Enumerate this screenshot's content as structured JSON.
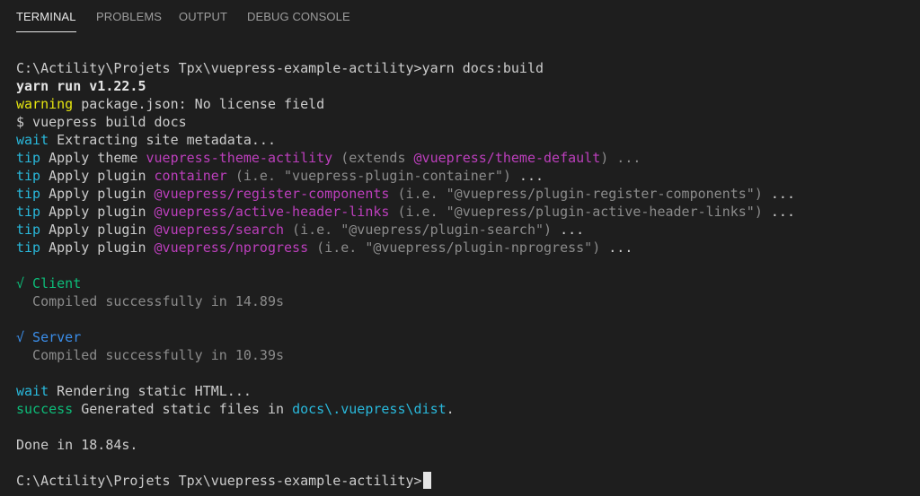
{
  "tabs": {
    "terminal": "TERMINAL",
    "problems": "PROBLEMS",
    "output": "OUTPUT",
    "debug_console": "DEBUG CONSOLE"
  },
  "terminal": {
    "prompt_command": "C:\\Actility\\Projets Tpx\\vuepress-example-actility>yarn docs:build",
    "yarn_run": "yarn run v1.22.5",
    "warning_tag": "warning",
    "warning_text": " package.json: No license field",
    "build_cmd": "$ vuepress build docs",
    "wait1_tag": "wait",
    "wait1_text": " Extracting site metadata...",
    "tip_tag": "tip",
    "theme": {
      "prefix": " Apply theme ",
      "name": "vuepress-theme-actility",
      "mid": " (extends ",
      "ext": "@vuepress/theme-default",
      "suffix": ") ..."
    },
    "plugins": [
      {
        "prefix": " Apply plugin ",
        "name": "container",
        "info": " (i.e. \"vuepress-plugin-container\")",
        "suffix": " ..."
      },
      {
        "prefix": " Apply plugin ",
        "name": "@vuepress/register-components",
        "info": " (i.e. \"@vuepress/plugin-register-components\")",
        "suffix": " ..."
      },
      {
        "prefix": " Apply plugin ",
        "name": "@vuepress/active-header-links",
        "info": " (i.e. \"@vuepress/plugin-active-header-links\")",
        "suffix": " ..."
      },
      {
        "prefix": " Apply plugin ",
        "name": "@vuepress/search",
        "info": " (i.e. \"@vuepress/plugin-search\")",
        "suffix": " ..."
      },
      {
        "prefix": " Apply plugin ",
        "name": "@vuepress/nprogress",
        "info": " (i.e. \"@vuepress/plugin-nprogress\")",
        "suffix": " ..."
      }
    ],
    "client": {
      "check": "√",
      "label": " Client",
      "compiled": "  Compiled successfully in 14.89s"
    },
    "server": {
      "check": "√",
      "label": " Server",
      "compiled": "  Compiled successfully in 10.39s"
    },
    "wait2_tag": "wait",
    "wait2_text": " Rendering static HTML...",
    "success_tag": "success",
    "success_text": " Generated static files in ",
    "success_path": "docs\\.vuepress\\dist",
    "success_end": ".",
    "done": "Done in 18.84s.",
    "final_prompt": "C:\\Actility\\Projets Tpx\\vuepress-example-actility>"
  },
  "colors": {
    "background": "#1e1e1e",
    "text": "#cccccc",
    "yellow": "#e5e510",
    "blue": "#3b8eea",
    "cyan": "#29b8db",
    "magenta": "#bc3fbc",
    "gray": "#8b8b8b",
    "green": "#23d18b"
  }
}
